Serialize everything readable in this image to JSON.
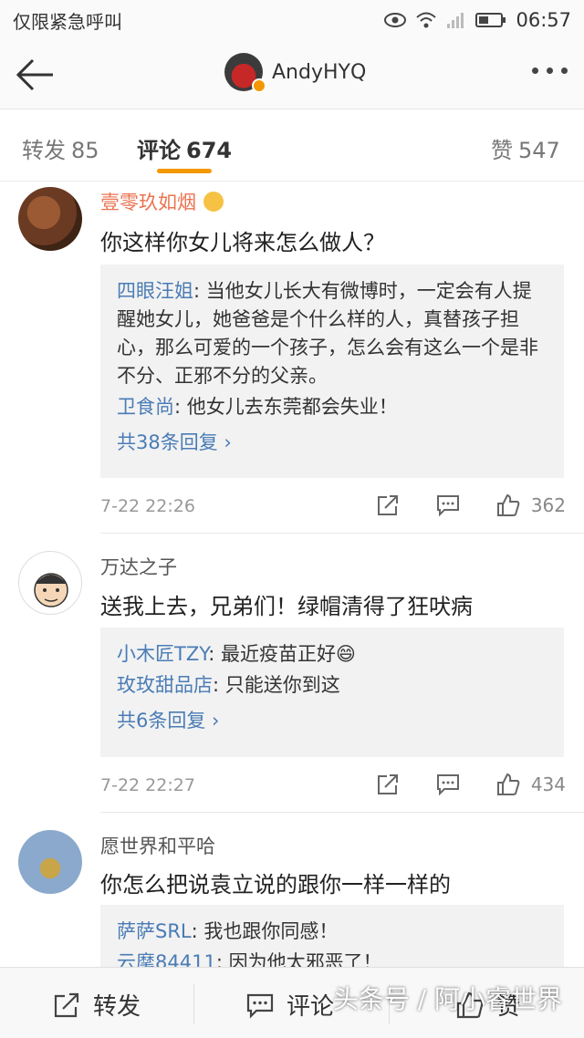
{
  "status": {
    "carrier": "仅限紧急呼叫",
    "time": "06:57"
  },
  "nav": {
    "title": "AndyHYQ"
  },
  "tabs": [
    {
      "label": "转发",
      "count": "85"
    },
    {
      "label": "评论",
      "count": "674"
    },
    {
      "label": "赞",
      "count": "547"
    }
  ],
  "comments": [
    {
      "user": "壹零玖如烟",
      "text": "你这样你女儿将来怎么做人？",
      "replies": [
        {
          "name": "四眼汪姐",
          "text": ": 当他女儿长大有微博时，一定会有人提醒她女儿，她爸爸是个什么样的人，真替孩子担心，那么可爱的一个孩子，怎么会有这么一个是非不分、正邪不分的父亲。"
        },
        {
          "name": "卫食尚",
          "text": ": 他女儿去东莞都会失业！"
        }
      ],
      "more": "共38条回复 ›",
      "time": "7-22 22:26",
      "likes": "362"
    },
    {
      "user": "万达之子",
      "text": "送我上去，兄弟们！绿帽清得了狂吠病",
      "replies": [
        {
          "name": "小木匠TZY",
          "text": ": 最近疫苗正好😄"
        },
        {
          "name": "玫玫甜品店",
          "text": ": 只能送你到这"
        }
      ],
      "more": "共6条回复 ›",
      "time": "7-22 22:27",
      "likes": "434"
    },
    {
      "user": "愿世界和平哈",
      "text": "你怎么把说袁立说的跟你一样一样的",
      "replies": [
        {
          "name": "萨萨SRL",
          "text": ": 我也跟你同感！"
        },
        {
          "name": "云麾84411",
          "text": ": 因为他太邪恶了！"
        }
      ]
    }
  ],
  "bottom": {
    "repost": "转发",
    "comment": "评论",
    "like": "赞"
  },
  "watermark": "头条号 / 阿小睿世界"
}
